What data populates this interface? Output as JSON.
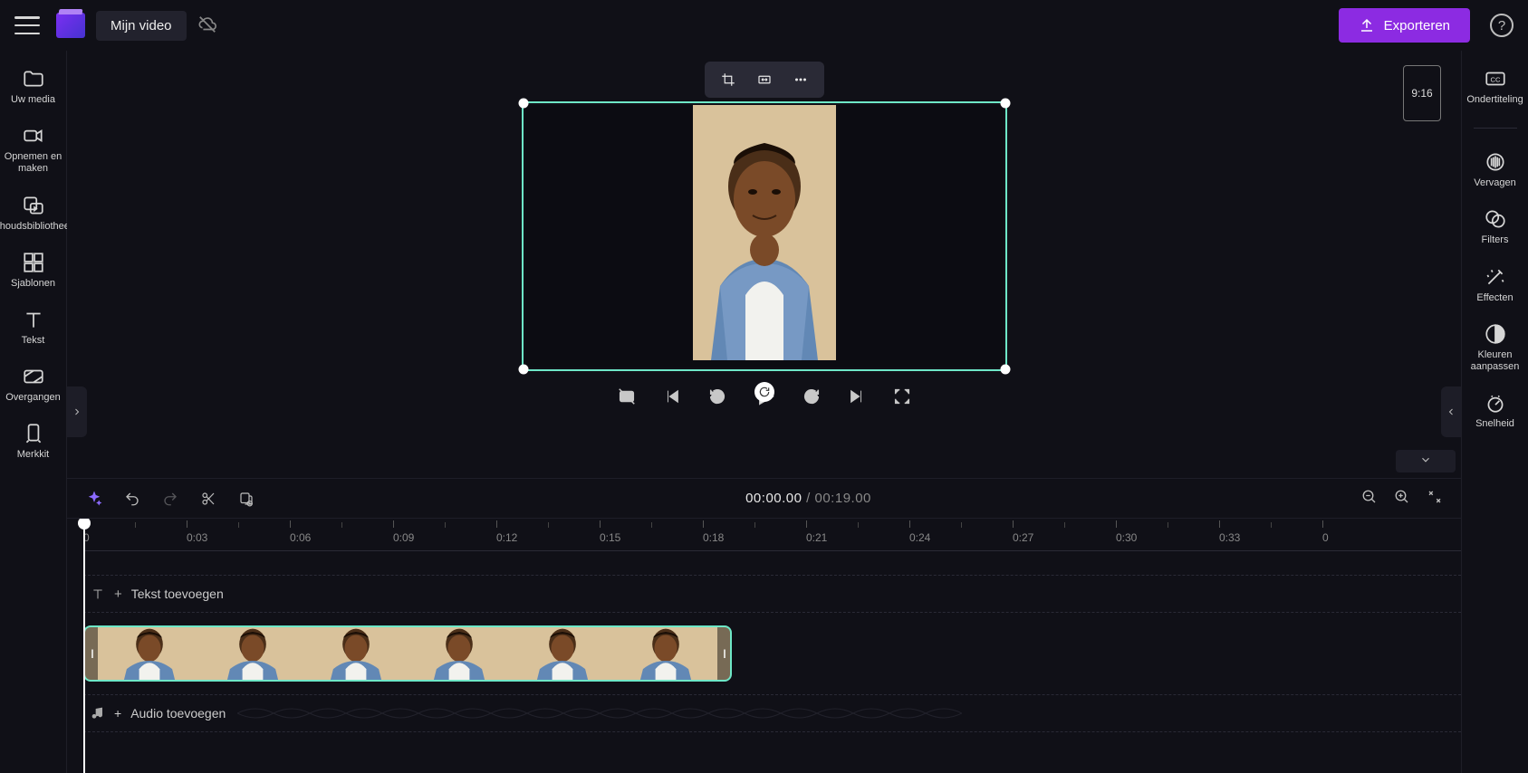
{
  "header": {
    "project_title": "Mijn video",
    "export_label": "Exporteren"
  },
  "aspect_ratio": "9:16",
  "left_rail": {
    "media": "Uw media",
    "record": "Opnemen en maken",
    "library": "Inhoudsbibliotheek",
    "templates": "Sjablonen",
    "text": "Tekst",
    "transitions": "Overgangen",
    "brandkit": "Merkkit"
  },
  "right_rail": {
    "subtitles": "Ondertiteling",
    "blur": "Vervagen",
    "filters": "Filters",
    "effects": "Effecten",
    "colors": "Kleuren aanpassen",
    "speed": "Snelheid"
  },
  "time": {
    "current": "00:00.00",
    "total": "00:19.00"
  },
  "skip_amount": "5",
  "ruler_ticks": [
    "0",
    "0:03",
    "0:06",
    "0:09",
    "0:12",
    "0:15",
    "0:18",
    "0:21",
    "0:24",
    "0:27",
    "0:30",
    "0:33",
    "0"
  ],
  "timeline": {
    "add_text": "Tekst toevoegen",
    "add_audio": "Audio toevoegen"
  }
}
